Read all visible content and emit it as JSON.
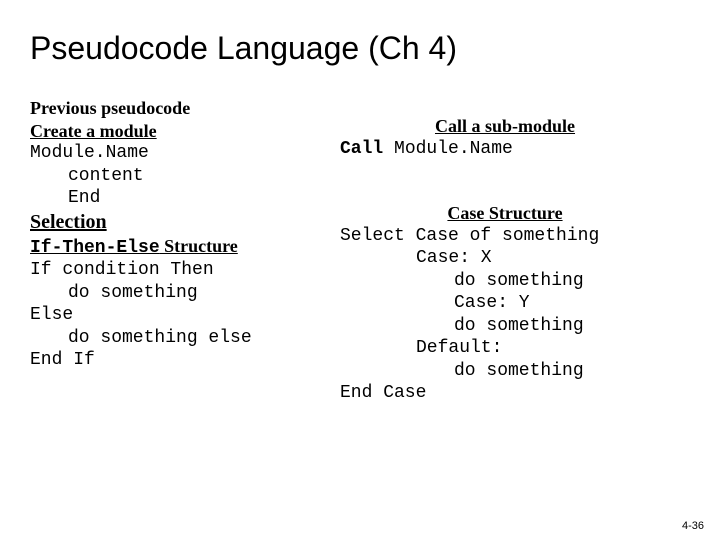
{
  "title": "Pseudocode Language (Ch 4)",
  "left": {
    "prev": "Previous pseudocode",
    "create_h": "Create a module",
    "mod_name": "Module.Name",
    "content": "content",
    "end": "End",
    "selection": "Selection",
    "ite_h_pre": "If-Then-Else",
    "ite_h_post": " Structure",
    "if_line": "If condition Then",
    "do1": "do something",
    "else": "Else",
    "do2": "do something else",
    "endif": "End If"
  },
  "right": {
    "call_h": "Call a sub-module",
    "call_pre": "Call",
    "call_post": " Module.Name",
    "case_h": "Case Structure",
    "select": "Select Case of something",
    "case_x": "Case: X",
    "do_x": "do something",
    "case_y": "Case: Y",
    "do_y": "do something",
    "default": "Default:",
    "do_d": "do something",
    "end_case": "End Case"
  },
  "page": "4-36"
}
